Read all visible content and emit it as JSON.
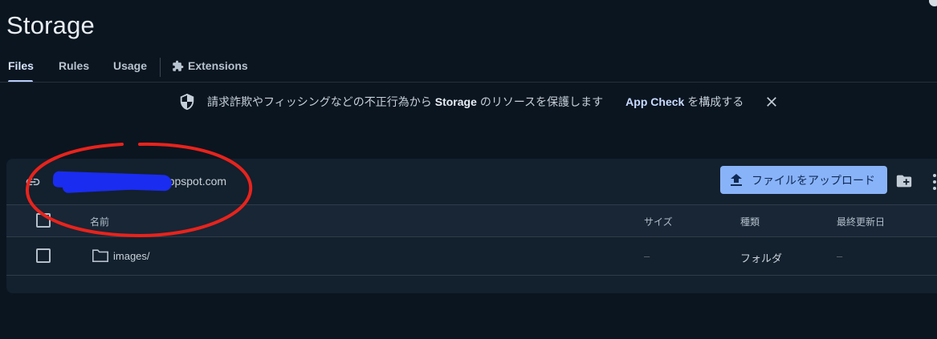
{
  "page": {
    "title": "Storage"
  },
  "tabs": [
    {
      "label": "Files",
      "active": true
    },
    {
      "label": "Rules"
    },
    {
      "label": "Usage"
    },
    {
      "label": "Extensions",
      "icon": "puzzle-icon"
    }
  ],
  "banner": {
    "icon": "shield-icon",
    "text_before": "請求詐欺やフィッシングなどの不正行為から",
    "text_bold": "Storage",
    "text_after": "のリソースを保護します",
    "link_label": "App Check",
    "link_suffix": "を構成する",
    "close_icon": "close-icon"
  },
  "bucket": {
    "link_icon": "link-icon",
    "name_visible": ".appspot.com",
    "upload_label": "ファイルをアップロード",
    "upload_icon": "upload-icon",
    "folder_add_icon": "create-folder-icon",
    "more_icon": "more-vert-icon"
  },
  "table": {
    "columns": [
      "名前",
      "サイズ",
      "種類",
      "最終更新日"
    ],
    "rows": [
      {
        "name": "images/",
        "size": "–",
        "type": "フォルダ",
        "modified": "–",
        "icon": "folder-icon"
      }
    ]
  },
  "colors": {
    "background": "#0b1520",
    "card": "#13202d",
    "accent_button": "#89b3f8",
    "annotation_red": "#e8231c",
    "redaction_blue": "#1a2cf0"
  }
}
